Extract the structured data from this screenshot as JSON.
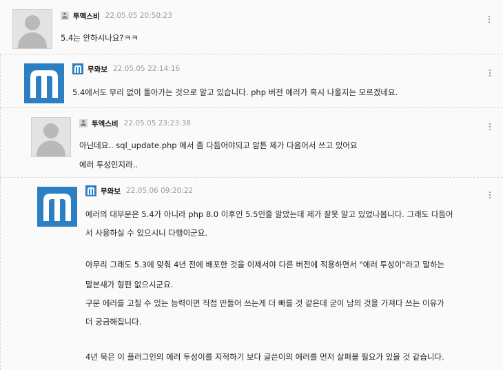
{
  "comments": [
    {
      "author": "투엑스비",
      "date": "22.05.05 20:50:23",
      "avatar": "default-user-avatar",
      "lines": [
        "5.4는 안하시나요?ㅋㅋ"
      ]
    },
    {
      "author": "무와보",
      "date": "22.05.05 22:14:16",
      "avatar": "m-logo-avatar",
      "lines": [
        "5.4에서도 무리 없이 돌아가는 것으로 알고 있습니다. php 버전 에러가 혹시 나올지는 모르겠네요."
      ]
    },
    {
      "author": "투엑스비",
      "date": "22.05.05 23:23:38",
      "avatar": "default-user-avatar",
      "lines": [
        "아닌데요.. sql_update.php 에서 좀 다듬어야되고 암튼 제가 다음어서 쓰고 있어요",
        "에러 투성인지라.."
      ]
    },
    {
      "author": "무와보",
      "date": "22.05.06 09:20:22",
      "avatar": "m-logo-avatar",
      "lines": [
        "에러의 대부분은 5.4가 아니라 php 8.0 이후인 5.5인줄 알았는데 제가 잘못 알고 있었나봅니다. 그래도 다듬어",
        "서 사용하실 수 있으시니 다행이군요.",
        "",
        "아무리 그래도 5.3에 맞춰 4년 전에 배포한 것을 이제서야 다른 버전에 적용하면서 \"에러 투성이\"라고 말하는",
        "말본새가 형편 없으시군요.",
        "구문 에러를 고칠 수 있는 능력이면 직접 만들어 쓰는게 더 빠를 것 같은데 굳이 남의 것을 가져다 쓰는 이유가",
        "더 궁금해집니다.",
        "",
        "4년 묵은 이 플러그인의 에러 투성이를 지적하기 보다 글쓴이의 에러를 먼저 살펴볼 필요가 있을 것 같습니다."
      ]
    }
  ],
  "colors": {
    "accent": "#2c7fc2",
    "background": "#fafafa",
    "date": "#9a9a9a"
  }
}
